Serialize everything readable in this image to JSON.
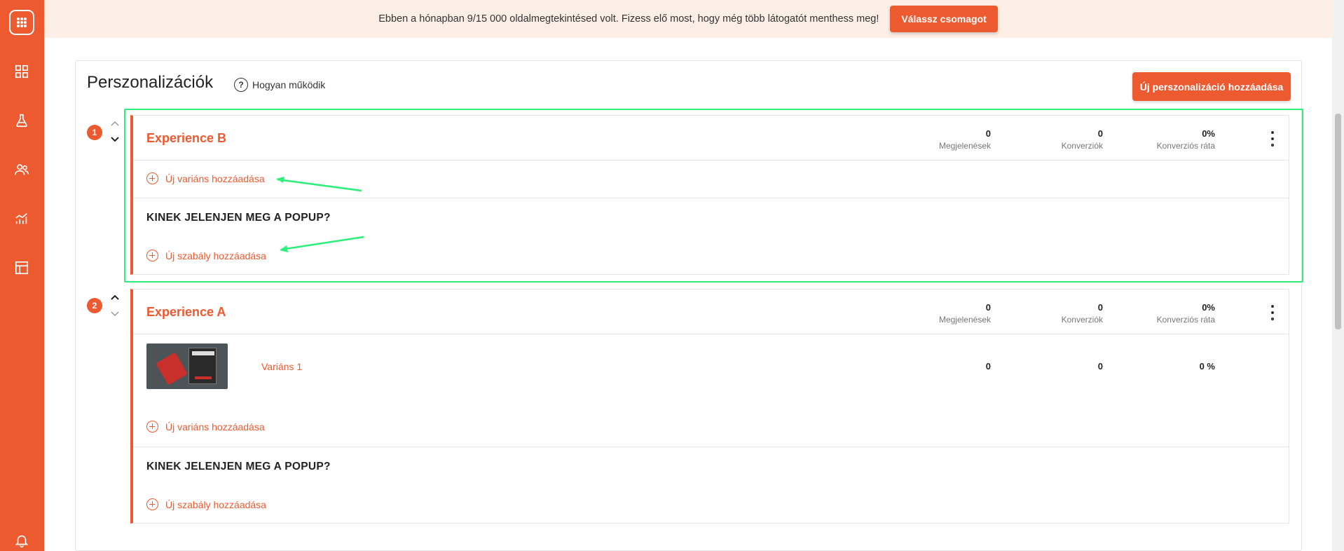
{
  "banner": {
    "text": "Ebben a hónapban 9/15 000 oldalmegtekintésed volt. Fizess elő most, hogy még több látogatót menthess meg!",
    "button": "Válassz csomagot"
  },
  "sidebar": {
    "items": [
      {
        "icon": "dashboard-icon"
      },
      {
        "icon": "flask-icon"
      },
      {
        "icon": "users-icon"
      },
      {
        "icon": "analytics-icon"
      },
      {
        "icon": "layout-icon"
      },
      {
        "icon": "bell-icon"
      }
    ]
  },
  "page": {
    "title": "Perszonalizációk",
    "how_it_works": "Hogyan működik",
    "how_icon": "?",
    "add_button": "Új perszonalizáció hozzáadása"
  },
  "experiences": [
    {
      "number": "1",
      "title": "Experience B",
      "stats": [
        {
          "value": "0",
          "label": "Megjelenések"
        },
        {
          "value": "0",
          "label": "Konverziók"
        },
        {
          "value": "0%",
          "label": "Konverziós ráta"
        }
      ],
      "add_variant": "Új variáns hozzáadása",
      "section_title": "KINEK JELENJEN MEG A POPUP?",
      "add_rule": "Új szabály hozzáadása"
    },
    {
      "number": "2",
      "title": "Experience A",
      "stats": [
        {
          "value": "0",
          "label": "Megjelenések"
        },
        {
          "value": "0",
          "label": "Konverziók"
        },
        {
          "value": "0%",
          "label": "Konverziós ráta"
        }
      ],
      "variants": [
        {
          "name": "Variáns 1",
          "values": [
            "0",
            "0",
            "0 %"
          ]
        }
      ],
      "add_variant": "Új variáns hozzáadása",
      "section_title": "KINEK JELENJEN MEG A POPUP?",
      "add_rule": "Új szabály hozzáadása"
    }
  ],
  "colors": {
    "brand": "#ed5a30",
    "highlight": "#2cf07a",
    "banner_bg": "#fdeee6"
  }
}
